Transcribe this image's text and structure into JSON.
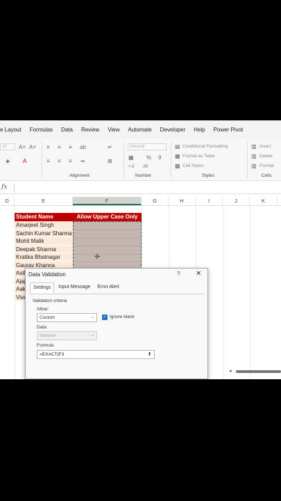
{
  "menu": [
    "e Layout",
    "Formulas",
    "Data",
    "Review",
    "View",
    "Automate",
    "Developer",
    "Help",
    "Power Pivot"
  ],
  "ribbon": {
    "font_size": "10",
    "number_format": "General",
    "conditional_formatting": "Conditional Formatting",
    "format_as_table": "Format as Table",
    "cell_styles": "Cell Styles",
    "insert": "Insert",
    "delete": "Delete",
    "format": "Format",
    "groups": {
      "alignment": "Alignment",
      "number": "Number",
      "styles": "Styles",
      "cells": "Cells"
    }
  },
  "formula_bar": {
    "fx": "fx"
  },
  "columns": [
    "D",
    "E",
    "F",
    "G",
    "H",
    "I",
    "J",
    "K"
  ],
  "table": {
    "header_name": "Student Name",
    "header_check": "Allow Upper Case Only",
    "names": [
      "Amarjeet Singh",
      "Sachin Kumar Sharma",
      "Mohit Malik",
      "Deepak Sharma",
      "Kratika Bhatnagar",
      "Gaurav Khanna",
      "Asif",
      "Ajaj",
      "Aak",
      "Vive"
    ]
  },
  "dialog": {
    "title": "Data Validation",
    "help": "?",
    "close": "✕",
    "tabs": [
      "Settings",
      "Input Message",
      "Error Alert"
    ],
    "section": "Validation criteria",
    "allow_label": "Allow:",
    "allow_value": "Custom",
    "ignore_blank": "Ignore blank",
    "data_label": "Data:",
    "data_value": "between",
    "formula_label": "Formula:",
    "formula_value": "=EXACT(F3"
  },
  "colors": {
    "header_red": "#c00000",
    "row_fill": "#fde9d9",
    "excel_green": "#217346"
  }
}
